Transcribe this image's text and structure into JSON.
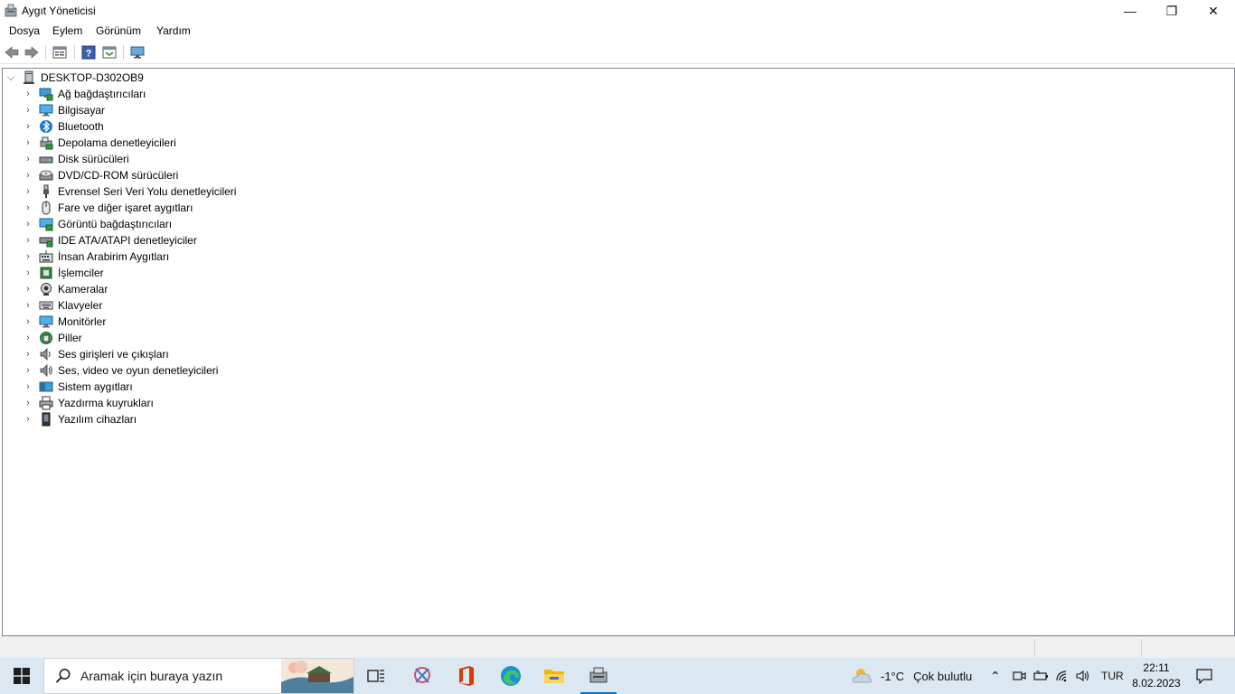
{
  "window": {
    "title": "Aygıt Yöneticisi",
    "app_icon": "device-manager-icon"
  },
  "window_controls": {
    "minimize": "—",
    "maximize": "❐",
    "close": "✕"
  },
  "menu": [
    "Dosya",
    "Eylem",
    "Görünüm",
    "Yardım"
  ],
  "toolbar": [
    "back-arrow-icon",
    "forward-arrow-icon",
    "properties-icon",
    "help-icon",
    "update-driver-icon",
    "monitor-scan-icon"
  ],
  "tree": {
    "root": {
      "label": "DESKTOP-D302OB9",
      "icon": "computer-tower-icon",
      "expanded": true
    },
    "items": [
      {
        "label": "Ağ bağdaştırıcıları",
        "icon": "network-adapter-icon"
      },
      {
        "label": "Bilgisayar",
        "icon": "computer-icon"
      },
      {
        "label": "Bluetooth",
        "icon": "bluetooth-icon"
      },
      {
        "label": "Depolama denetleyicileri",
        "icon": "storage-controller-icon"
      },
      {
        "label": "Disk sürücüleri",
        "icon": "disk-drive-icon"
      },
      {
        "label": "DVD/CD-ROM sürücüleri",
        "icon": "dvd-icon"
      },
      {
        "label": "Evrensel Seri Veri Yolu denetleyicileri",
        "icon": "usb-icon"
      },
      {
        "label": "Fare ve diğer işaret aygıtları",
        "icon": "mouse-icon"
      },
      {
        "label": "Görüntü bağdaştırıcıları",
        "icon": "display-adapter-icon"
      },
      {
        "label": "IDE ATA/ATAPI denetleyiciler",
        "icon": "ide-controller-icon"
      },
      {
        "label": "İnsan Arabirim Aygıtları",
        "icon": "hid-icon"
      },
      {
        "label": "İşlemciler",
        "icon": "processor-icon"
      },
      {
        "label": "Kameralar",
        "icon": "camera-icon"
      },
      {
        "label": "Klavyeler",
        "icon": "keyboard-icon"
      },
      {
        "label": "Monitörler",
        "icon": "monitor-icon"
      },
      {
        "label": "Piller",
        "icon": "battery-icon"
      },
      {
        "label": "Ses girişleri ve çıkışları",
        "icon": "speaker-icon"
      },
      {
        "label": "Ses, video ve oyun denetleyicileri",
        "icon": "sound-controller-icon"
      },
      {
        "label": "Sistem aygıtları",
        "icon": "system-devices-icon"
      },
      {
        "label": "Yazdırma kuyrukları",
        "icon": "printer-icon"
      },
      {
        "label": "Yazılım cihazları",
        "icon": "software-device-icon"
      }
    ]
  },
  "taskbar": {
    "search_placeholder": "Aramak için buraya yazın",
    "apps": [
      "task-view-icon",
      "snip-tool-icon",
      "office-icon",
      "edge-icon",
      "file-explorer-icon",
      "device-manager-taskbar-icon"
    ],
    "weather": {
      "temp": "-1°C",
      "desc": "Çok bulutlu"
    },
    "language": "TUR",
    "time": "22:11",
    "date": "8.02.2023"
  },
  "colors": {
    "accent": "#0078d4",
    "taskbar": "#dbe7f1",
    "office": "#d83b01"
  }
}
